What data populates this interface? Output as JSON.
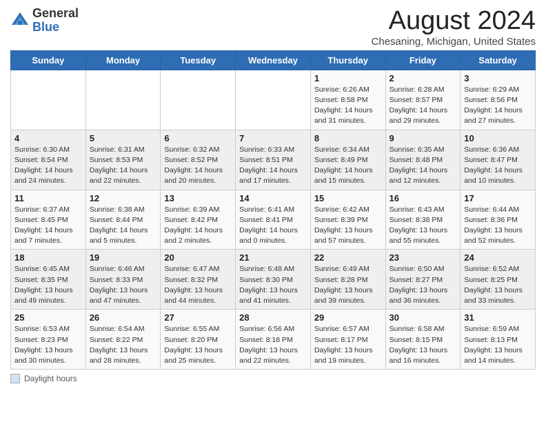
{
  "header": {
    "logo_general": "General",
    "logo_blue": "Blue",
    "title": "August 2024",
    "subtitle": "Chesaning, Michigan, United States"
  },
  "days_of_week": [
    "Sunday",
    "Monday",
    "Tuesday",
    "Wednesday",
    "Thursday",
    "Friday",
    "Saturday"
  ],
  "footer": {
    "label": "Daylight hours"
  },
  "weeks": [
    [
      {
        "day": "",
        "info": ""
      },
      {
        "day": "",
        "info": ""
      },
      {
        "day": "",
        "info": ""
      },
      {
        "day": "",
        "info": ""
      },
      {
        "day": "1",
        "info": "Sunrise: 6:26 AM\nSunset: 8:58 PM\nDaylight: 14 hours and 31 minutes."
      },
      {
        "day": "2",
        "info": "Sunrise: 6:28 AM\nSunset: 8:57 PM\nDaylight: 14 hours and 29 minutes."
      },
      {
        "day": "3",
        "info": "Sunrise: 6:29 AM\nSunset: 8:56 PM\nDaylight: 14 hours and 27 minutes."
      }
    ],
    [
      {
        "day": "4",
        "info": "Sunrise: 6:30 AM\nSunset: 8:54 PM\nDaylight: 14 hours and 24 minutes."
      },
      {
        "day": "5",
        "info": "Sunrise: 6:31 AM\nSunset: 8:53 PM\nDaylight: 14 hours and 22 minutes."
      },
      {
        "day": "6",
        "info": "Sunrise: 6:32 AM\nSunset: 8:52 PM\nDaylight: 14 hours and 20 minutes."
      },
      {
        "day": "7",
        "info": "Sunrise: 6:33 AM\nSunset: 8:51 PM\nDaylight: 14 hours and 17 minutes."
      },
      {
        "day": "8",
        "info": "Sunrise: 6:34 AM\nSunset: 8:49 PM\nDaylight: 14 hours and 15 minutes."
      },
      {
        "day": "9",
        "info": "Sunrise: 6:35 AM\nSunset: 8:48 PM\nDaylight: 14 hours and 12 minutes."
      },
      {
        "day": "10",
        "info": "Sunrise: 6:36 AM\nSunset: 8:47 PM\nDaylight: 14 hours and 10 minutes."
      }
    ],
    [
      {
        "day": "11",
        "info": "Sunrise: 6:37 AM\nSunset: 8:45 PM\nDaylight: 14 hours and 7 minutes."
      },
      {
        "day": "12",
        "info": "Sunrise: 6:38 AM\nSunset: 8:44 PM\nDaylight: 14 hours and 5 minutes."
      },
      {
        "day": "13",
        "info": "Sunrise: 6:39 AM\nSunset: 8:42 PM\nDaylight: 14 hours and 2 minutes."
      },
      {
        "day": "14",
        "info": "Sunrise: 6:41 AM\nSunset: 8:41 PM\nDaylight: 14 hours and 0 minutes."
      },
      {
        "day": "15",
        "info": "Sunrise: 6:42 AM\nSunset: 8:39 PM\nDaylight: 13 hours and 57 minutes."
      },
      {
        "day": "16",
        "info": "Sunrise: 6:43 AM\nSunset: 8:38 PM\nDaylight: 13 hours and 55 minutes."
      },
      {
        "day": "17",
        "info": "Sunrise: 6:44 AM\nSunset: 8:36 PM\nDaylight: 13 hours and 52 minutes."
      }
    ],
    [
      {
        "day": "18",
        "info": "Sunrise: 6:45 AM\nSunset: 8:35 PM\nDaylight: 13 hours and 49 minutes."
      },
      {
        "day": "19",
        "info": "Sunrise: 6:46 AM\nSunset: 8:33 PM\nDaylight: 13 hours and 47 minutes."
      },
      {
        "day": "20",
        "info": "Sunrise: 6:47 AM\nSunset: 8:32 PM\nDaylight: 13 hours and 44 minutes."
      },
      {
        "day": "21",
        "info": "Sunrise: 6:48 AM\nSunset: 8:30 PM\nDaylight: 13 hours and 41 minutes."
      },
      {
        "day": "22",
        "info": "Sunrise: 6:49 AM\nSunset: 8:28 PM\nDaylight: 13 hours and 39 minutes."
      },
      {
        "day": "23",
        "info": "Sunrise: 6:50 AM\nSunset: 8:27 PM\nDaylight: 13 hours and 36 minutes."
      },
      {
        "day": "24",
        "info": "Sunrise: 6:52 AM\nSunset: 8:25 PM\nDaylight: 13 hours and 33 minutes."
      }
    ],
    [
      {
        "day": "25",
        "info": "Sunrise: 6:53 AM\nSunset: 8:23 PM\nDaylight: 13 hours and 30 minutes."
      },
      {
        "day": "26",
        "info": "Sunrise: 6:54 AM\nSunset: 8:22 PM\nDaylight: 13 hours and 28 minutes."
      },
      {
        "day": "27",
        "info": "Sunrise: 6:55 AM\nSunset: 8:20 PM\nDaylight: 13 hours and 25 minutes."
      },
      {
        "day": "28",
        "info": "Sunrise: 6:56 AM\nSunset: 8:18 PM\nDaylight: 13 hours and 22 minutes."
      },
      {
        "day": "29",
        "info": "Sunrise: 6:57 AM\nSunset: 8:17 PM\nDaylight: 13 hours and 19 minutes."
      },
      {
        "day": "30",
        "info": "Sunrise: 6:58 AM\nSunset: 8:15 PM\nDaylight: 13 hours and 16 minutes."
      },
      {
        "day": "31",
        "info": "Sunrise: 6:59 AM\nSunset: 8:13 PM\nDaylight: 13 hours and 14 minutes."
      }
    ]
  ]
}
